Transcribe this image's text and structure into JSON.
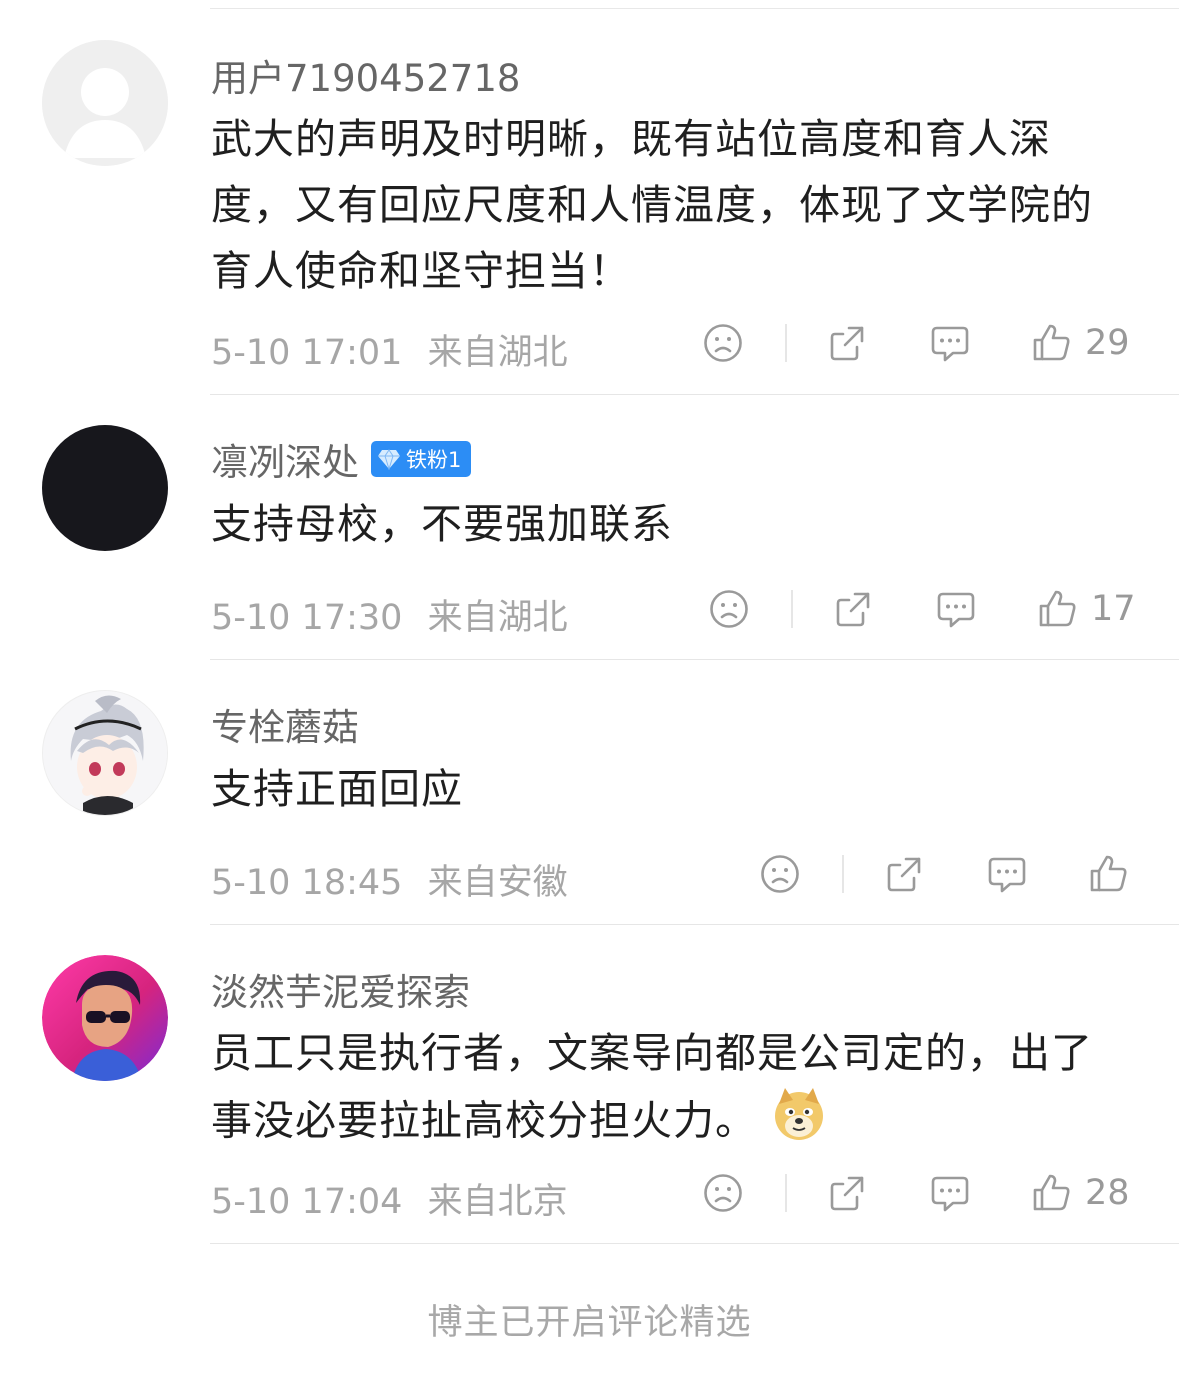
{
  "comments": [
    {
      "user": "用户7190452718",
      "text": "武大的声明及时明晰，既有站位高度和育人深度，又有回应尺度和人情温度，体现了文学院的育人使命和坚守担当！",
      "time": "5-10 17:01",
      "location": "来自湖北",
      "likes": "29",
      "avatar": "default-avatar"
    },
    {
      "user": "凛冽深处",
      "badge": "铁粉1",
      "text": "支持母校，不要强加联系",
      "time": "5-10 17:30",
      "location": "来自湖北",
      "likes": "17",
      "avatar": "black-circle"
    },
    {
      "user": "专栓蘑菇",
      "text": "支持正面回应",
      "time": "5-10 18:45",
      "location": "来自安徽",
      "likes": "",
      "avatar": "anime-character"
    },
    {
      "user": "淡然芋泥爱探索",
      "text": "员工只是执行者，文案导向都是公司定的，出了事没必要拉扯高校分担火力。",
      "emoji": "doge-emoji",
      "time": "5-10 17:04",
      "location": "来自北京",
      "likes": "28",
      "avatar": "sunglasses-man"
    }
  ],
  "footer": "博主已开启评论精选",
  "colors": {
    "badge": "#2c8df5",
    "meta": "#a6a6a6",
    "icon": "#9a9a9a"
  }
}
